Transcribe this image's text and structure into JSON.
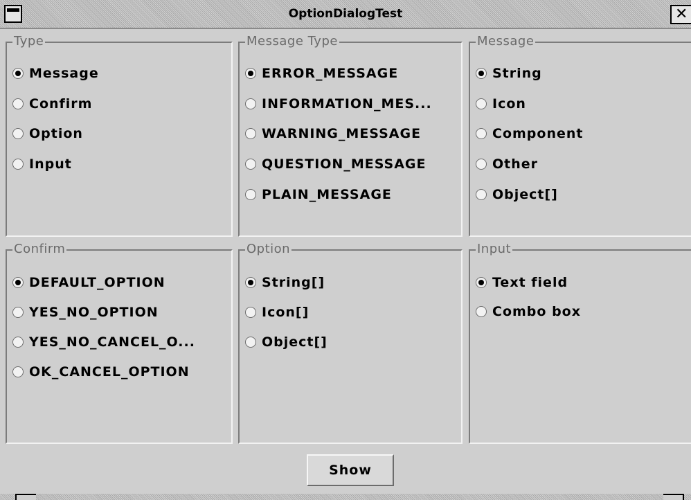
{
  "window": {
    "title": "OptionDialogTest",
    "close_glyph": "✕",
    "titlebar_color": "#bcbcbc",
    "background_color": "#cfcfcf"
  },
  "panels": {
    "type": {
      "title": "Type",
      "options": [
        {
          "label": "Message",
          "checked": true
        },
        {
          "label": "Confirm",
          "checked": false
        },
        {
          "label": "Option",
          "checked": false
        },
        {
          "label": "Input",
          "checked": false
        }
      ]
    },
    "message_type": {
      "title": "Message Type",
      "options": [
        {
          "label": "ERROR_MESSAGE",
          "checked": true
        },
        {
          "label": "INFORMATION_MES...",
          "checked": false
        },
        {
          "label": "WARNING_MESSAGE",
          "checked": false
        },
        {
          "label": "QUESTION_MESSAGE",
          "checked": false
        },
        {
          "label": "PLAIN_MESSAGE",
          "checked": false
        }
      ]
    },
    "message": {
      "title": "Message",
      "options": [
        {
          "label": "String",
          "checked": true
        },
        {
          "label": "Icon",
          "checked": false
        },
        {
          "label": "Component",
          "checked": false
        },
        {
          "label": "Other",
          "checked": false
        },
        {
          "label": "Object[]",
          "checked": false
        }
      ]
    },
    "confirm": {
      "title": "Confirm",
      "options": [
        {
          "label": "DEFAULT_OPTION",
          "checked": true
        },
        {
          "label": "YES_NO_OPTION",
          "checked": false
        },
        {
          "label": "YES_NO_CANCEL_O...",
          "checked": false
        },
        {
          "label": "OK_CANCEL_OPTION",
          "checked": false
        }
      ]
    },
    "option": {
      "title": "Option",
      "options": [
        {
          "label": "String[]",
          "checked": true
        },
        {
          "label": "Icon[]",
          "checked": false
        },
        {
          "label": "Object[]",
          "checked": false
        }
      ]
    },
    "input": {
      "title": "Input",
      "options": [
        {
          "label": "Text field",
          "checked": true
        },
        {
          "label": "Combo box",
          "checked": false
        }
      ]
    }
  },
  "footer": {
    "show_label": "Show"
  }
}
